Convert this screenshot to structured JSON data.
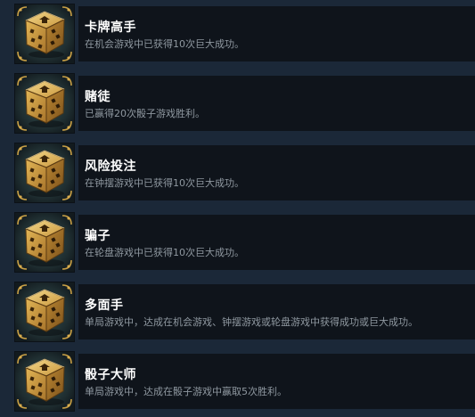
{
  "achievements": [
    {
      "title": "卡牌高手",
      "description": "在机会游戏中已获得10次巨大成功。",
      "icon": "gold-dice-icon"
    },
    {
      "title": "赌徒",
      "description": "已赢得20次骰子游戏胜利。",
      "icon": "gold-dice-icon"
    },
    {
      "title": "风险投注",
      "description": "在钟摆游戏中已获得10次巨大成功。",
      "icon": "gold-dice-icon"
    },
    {
      "title": "骗子",
      "description": "在轮盘游戏中已获得10次巨大成功。",
      "icon": "gold-dice-icon"
    },
    {
      "title": "多面手",
      "description": "单局游戏中，达成在机会游戏、钟摆游戏或轮盘游戏中获得成功或巨大成功。",
      "icon": "gold-dice-icon"
    },
    {
      "title": "骰子大师",
      "description": "单局游戏中，达成在骰子游戏中赢取5次胜利。",
      "icon": "gold-dice-icon"
    }
  ],
  "colors": {
    "page_background": "#1b2838",
    "panel_background": "#0f141b",
    "title_text": "#ffffff",
    "description_text": "#8f98a0",
    "icon_gold": "#d9ad4e",
    "icon_teal": "#2f4a4c"
  }
}
